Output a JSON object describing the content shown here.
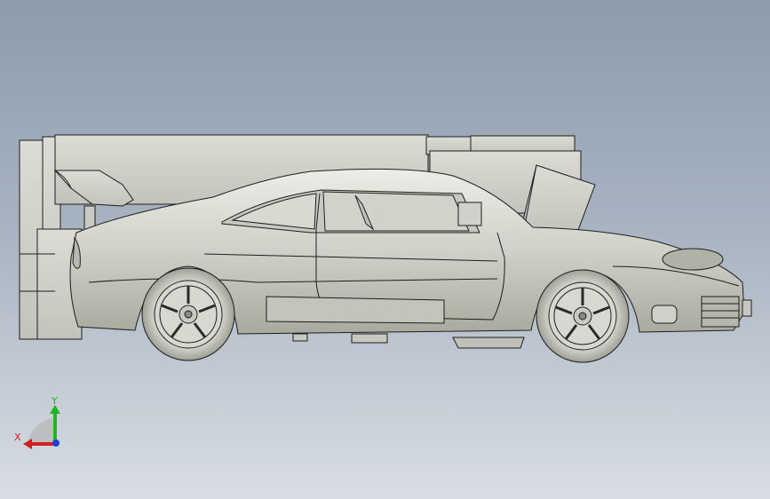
{
  "viewport": {
    "background_top": "#8d9bac",
    "background_bottom": "#d8dde3",
    "model_fill": "#d6d7cf",
    "model_shade": "#a9ab9f",
    "model_edge": "#1e1e1e"
  },
  "triad": {
    "x_label": "X",
    "y_label": "Y",
    "x_color": "#d32020",
    "y_color": "#23b323",
    "z_color": "#2040d8"
  }
}
